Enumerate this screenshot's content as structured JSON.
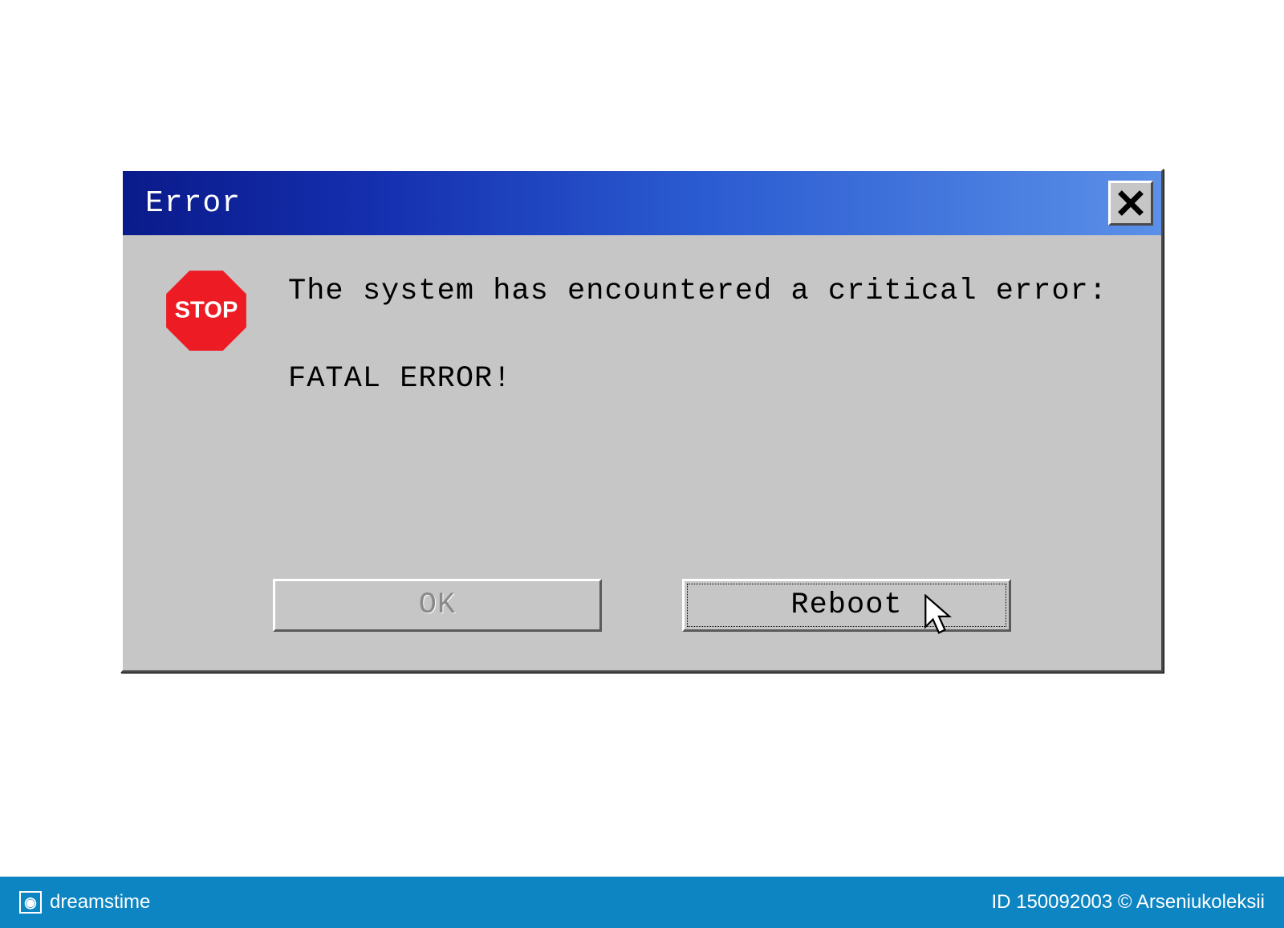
{
  "titlebar": {
    "title": "Error",
    "close_label": "Close"
  },
  "icon": {
    "name": "stop-icon",
    "label": "STOP"
  },
  "message": {
    "line1": "The system has encountered a critical error:",
    "line2": "FATAL ERROR!"
  },
  "buttons": {
    "ok_label": "OK",
    "reboot_label": "Reboot"
  },
  "footer": {
    "brand": "dreamstime",
    "id_label": "ID 150092003",
    "author": "© Arseniukoleksii"
  }
}
